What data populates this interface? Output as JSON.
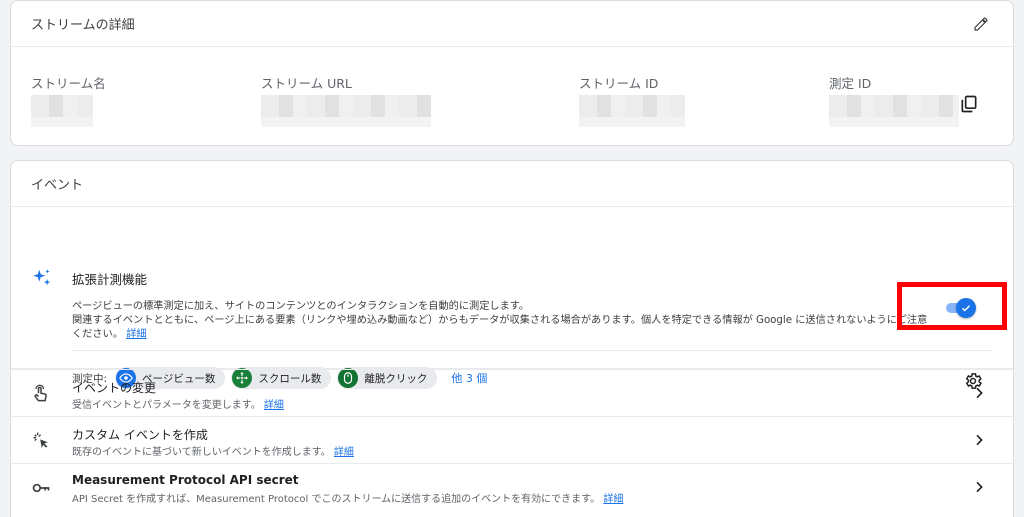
{
  "stream_details": {
    "title": "ストリームの詳細",
    "fields": [
      {
        "label": "ストリーム名"
      },
      {
        "label": "ストリーム URL"
      },
      {
        "label": "ストリーム ID"
      },
      {
        "label": "測定 ID"
      }
    ]
  },
  "events": {
    "title": "イベント",
    "enhanced": {
      "title": "拡張計測機能",
      "desc_line1": "ページビューの標準測定に加え、サイトのコンテンツとのインタラクションを自動的に測定します。",
      "desc_line2": "関連するイベントとともに、ページ上にある要素（リンクや埋め込み動画など）からもデータが収集される場合があります。個人を特定できる情報が Google に送信されないようにご注意",
      "desc_line3": "ください。",
      "details_link": "詳細",
      "toggle_on": true,
      "measuring_label": "測定中:",
      "chips": [
        {
          "label": "ページビュー数",
          "icon": "eye-icon",
          "color": "#1a73e8"
        },
        {
          "label": "スクロール数",
          "icon": "move-icon",
          "color": "#188038"
        },
        {
          "label": "離脱クリック",
          "icon": "mouse-icon",
          "color": "#137333"
        }
      ],
      "more": "他 3 個"
    },
    "rows": [
      {
        "title": "イベントの変更",
        "desc": "受信イベントとパラメータを変更します。",
        "link": "詳細",
        "icon": "touch-icon"
      },
      {
        "title": "カスタム イベントを作成",
        "desc": "既存のイベントに基づいて新しいイベントを作成します。",
        "link": "詳細",
        "icon": "click-icon"
      },
      {
        "title": "Measurement Protocol API secret",
        "desc": "API Secret を作成すれば、Measurement Protocol でこのストリームに送信する追加のイベントを有効にできます。",
        "link": "詳細",
        "icon": "key-icon"
      }
    ]
  }
}
